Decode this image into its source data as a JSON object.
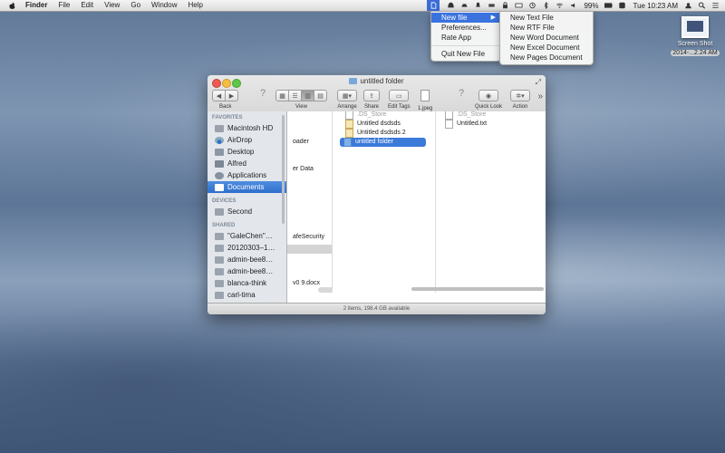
{
  "menubar": {
    "app": "Finder",
    "menus": [
      "File",
      "Edit",
      "View",
      "Go",
      "Window",
      "Help"
    ],
    "battery": "99%",
    "clock": "Tue 10:23 AM"
  },
  "status_menu": {
    "items": [
      "New file",
      "Preferences...",
      "Rate App",
      "Quit New File"
    ],
    "submenu": [
      "New Text File",
      "New RTF File",
      "New Word Document",
      "New Excel Document",
      "New Pages Document"
    ]
  },
  "desktop_icon": {
    "line1": "Screen Shot",
    "line2": "2014-...2.24 AM"
  },
  "window": {
    "title": "untitled folder",
    "toolbar": {
      "back": "Back",
      "view": "View",
      "arrange": "Arrange",
      "share": "Share",
      "edit_tags": "Edit Tags",
      "file": "1.jpeg",
      "quick_look": "Quick Look",
      "action": "Action",
      "overflow": "»"
    },
    "sidebar": {
      "favorites_header": "FAVORITES",
      "favorites": [
        "Macintosh HD",
        "AirDrop",
        "Desktop",
        "Alfred",
        "Applications",
        "Documents"
      ],
      "devices_header": "DEVICES",
      "devices": [
        "Second"
      ],
      "shared_header": "SHARED",
      "shared": [
        "\"GaleChen\"…",
        "20120303–1…",
        "admin-bee8…",
        "admin-bee8…",
        "blanca-think",
        "carl-tima"
      ]
    },
    "column1": [
      "oader",
      "er Data",
      "afeSecurity",
      "v0 9.docx"
    ],
    "column2": [
      ".DS_Store",
      "Untitled dsdsds",
      "Untitled dsdsds 2",
      "untitled folder"
    ],
    "column3": [
      ".DS_Store",
      "Untitled.txt"
    ],
    "status": "2 items, 198.4 GB available"
  }
}
